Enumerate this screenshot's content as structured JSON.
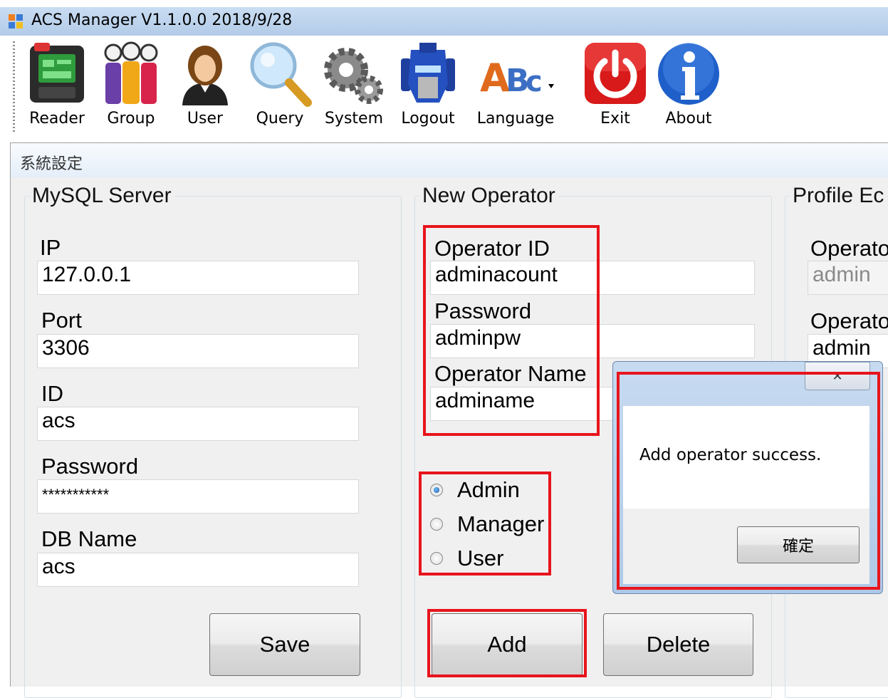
{
  "window": {
    "title": "ACS Manager V1.1.0.0  2018/9/28"
  },
  "toolbar": {
    "items": [
      {
        "label": "Reader",
        "icon": "reader-terminal-icon"
      },
      {
        "label": "Group",
        "icon": "group-people-icon"
      },
      {
        "label": "User",
        "icon": "user-avatar-icon"
      },
      {
        "label": "Query",
        "icon": "magnifier-icon"
      },
      {
        "label": "System",
        "icon": "gears-icon"
      },
      {
        "label": "Logout",
        "icon": "robot-head-icon"
      },
      {
        "label": "Language",
        "icon": "abc-language-icon"
      },
      {
        "label": "Exit",
        "icon": "power-icon"
      },
      {
        "label": "About",
        "icon": "info-icon"
      }
    ]
  },
  "panel": {
    "title": "系統設定"
  },
  "mysql": {
    "legend": "MySQL Server",
    "ip_label": "IP",
    "ip_value": "127.0.0.1",
    "port_label": "Port",
    "port_value": "3306",
    "id_label": "ID",
    "id_value": "acs",
    "password_label": "Password",
    "password_value": "***********",
    "dbname_label": "DB Name",
    "dbname_value": "acs",
    "save_label": "Save"
  },
  "new_operator": {
    "legend": "New Operator",
    "operator_id_label": "Operator ID",
    "operator_id_value": "adminacount",
    "password_label": "Password",
    "password_value": "adminpw",
    "operator_name_label": "Operator Name",
    "operator_name_value": "adminame",
    "roles": [
      {
        "label": "Admin",
        "selected": true
      },
      {
        "label": "Manager",
        "selected": false
      },
      {
        "label": "User",
        "selected": false
      }
    ],
    "add_label": "Add",
    "delete_label": "Delete"
  },
  "profile": {
    "legend": "Profile Ec",
    "label_1": "Operato",
    "value_1": "admin",
    "label_2": "Operato",
    "value_2": "admin"
  },
  "dialog": {
    "close_glyph": "✕",
    "message": "Add operator success.",
    "ok_label": "確定"
  },
  "colors": {
    "highlight": "#e8141c",
    "titlebar": "#b9d1ee",
    "panel": "#f0f0f0"
  }
}
